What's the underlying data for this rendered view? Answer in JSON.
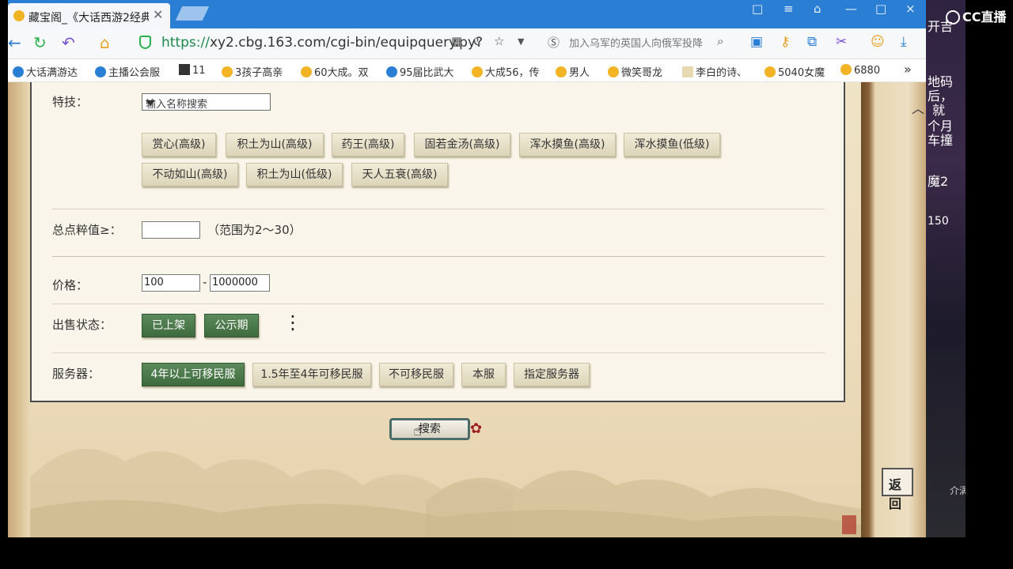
{
  "tab": {
    "title": "藏宝阁_《大话西游2经典"
  },
  "window_controls": [
    "□",
    "≡",
    "⌂",
    "—",
    "□",
    "×"
  ],
  "address": {
    "scheme": "https://",
    "rest": "xy2.cbg.163.com/cgi-bin/equipquery.py?",
    "news": "加入乌军的英国人向俄军投降"
  },
  "bookmarks": [
    "大话满游达",
    "主播公会服",
    "11",
    "3孩子高亲",
    "60大成。双",
    "95届比武大",
    "大成56，传",
    "男人",
    "微笑哥龙",
    "李白的诗、",
    "5040女魔",
    "6880"
  ],
  "form": {
    "skills_label": "特技：",
    "skills_placeholder": "输入名称搜索",
    "skill_buttons": [
      "赏心(高级)",
      "积土为山(高级)",
      "药王(高级)",
      "固若金汤(高级)",
      "浑水摸鱼(高级)",
      "浑水摸鱼(低级)",
      "不动如山(高级)",
      "积土为山(低级)",
      "天人五衰(高级)"
    ],
    "total_label": "总点粹值≥：",
    "total_value": "",
    "total_note": "（范围为2～30）",
    "price_label": "价格：",
    "price_min": "100",
    "price_dash": "-",
    "price_max": "1000000",
    "sale_label": "出售状态：",
    "sale_buttons": [
      "已上架",
      "公示期"
    ],
    "server_label": "服务器：",
    "server_buttons": [
      "4年以上可移民服",
      "1.5年至4年可移民服",
      "不可移民服",
      "本服",
      "指定服务器"
    ]
  },
  "search_label": "搜索",
  "back_label": "返回",
  "overlay": {
    "brand": "CC直播",
    "lines": [
      "开吉",
      "地码",
      "后，",
      "就",
      "个月",
      "车撞",
      "魔2",
      "150",
      "介满"
    ]
  }
}
